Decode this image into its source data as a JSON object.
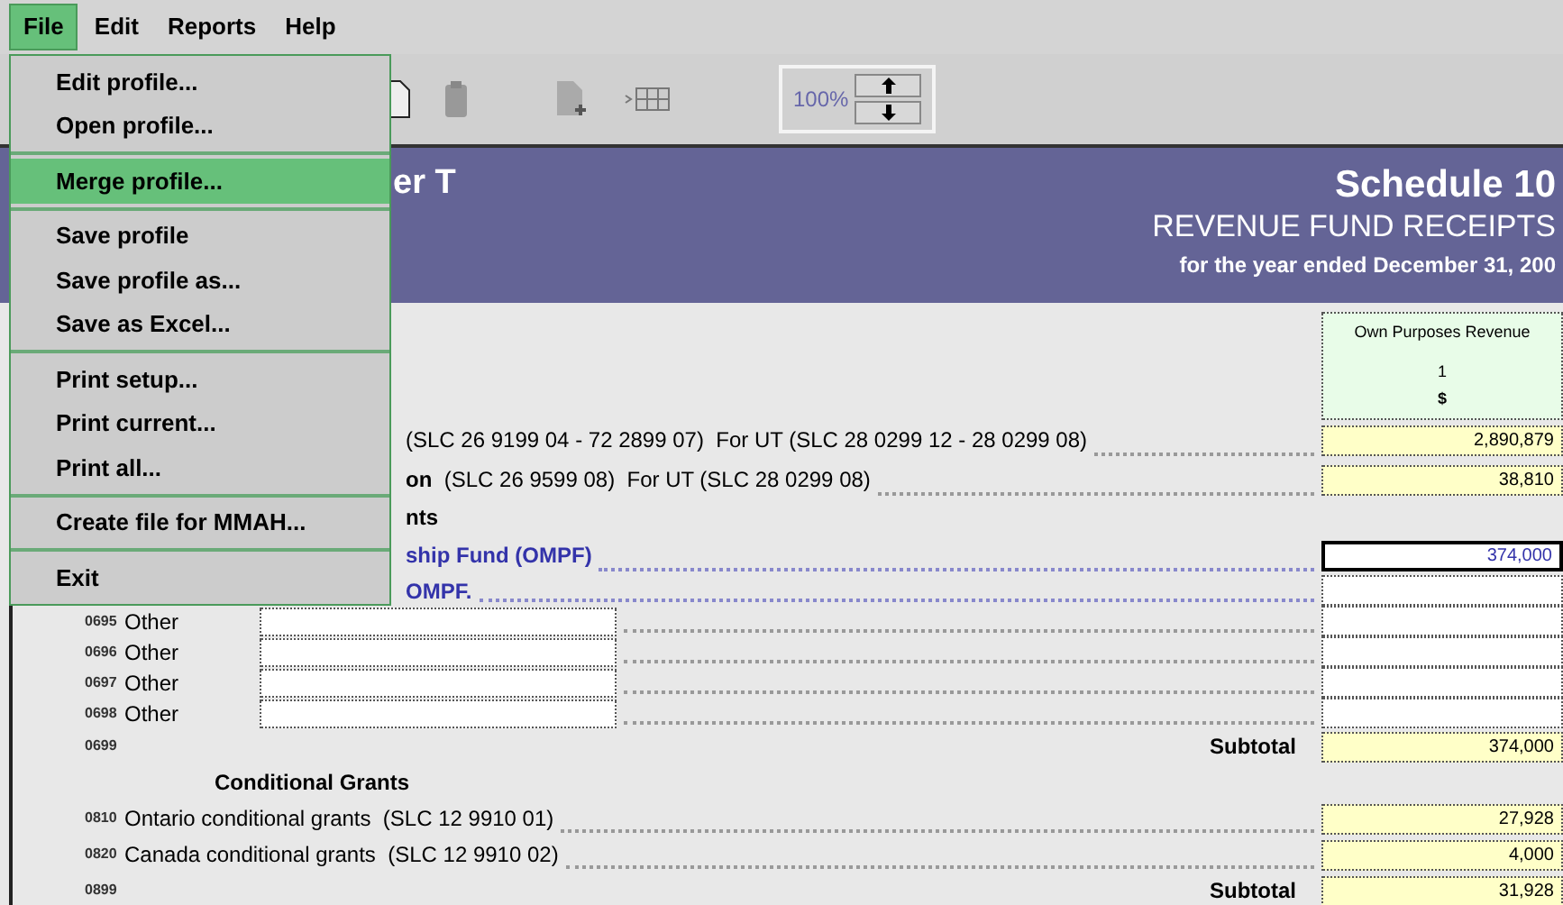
{
  "menubar": [
    {
      "label": "File",
      "selected": true
    },
    {
      "label": "Edit",
      "selected": false
    },
    {
      "label": "Reports",
      "selected": false
    },
    {
      "label": "Help",
      "selected": false
    }
  ],
  "file_menu": {
    "groups": [
      [
        {
          "label": "Edit profile...",
          "selected": false
        },
        {
          "label": "Open profile...",
          "selected": false
        }
      ],
      [
        {
          "label": "Merge profile...",
          "selected": true
        }
      ],
      [
        {
          "label": "Save profile",
          "selected": false
        },
        {
          "label": "Save profile as...",
          "selected": false
        },
        {
          "label": "Save as Excel...",
          "selected": false
        }
      ],
      [
        {
          "label": "Print setup...",
          "selected": false
        },
        {
          "label": "Print current...",
          "selected": false
        },
        {
          "label": "Print all...",
          "selected": false
        }
      ],
      [
        {
          "label": "Create file for MMAH...",
          "selected": false
        }
      ],
      [
        {
          "label": "Exit",
          "selected": false
        }
      ]
    ]
  },
  "toolbar": {
    "zoom": "100%"
  },
  "header": {
    "title": "er T",
    "schedule": "Schedule 10",
    "subtitle": "REVENUE FUND RECEIPTS",
    "period": "for the year ended December 31, 200"
  },
  "column": {
    "title": "Own Purposes Revenue",
    "number": "1",
    "unit": "$"
  },
  "rows": [
    {
      "kind": "line",
      "covered": true,
      "blue": false,
      "text": "(SLC 26 9199 04 - 72 2899 07)  For UT (SLC 28 0299 12 - 28 0299 08)",
      "computed": true,
      "value": "2,890,879"
    },
    {
      "kind": "line",
      "covered": true,
      "blue": false,
      "text": "**on**  (SLC 26 9599 08)  For UT (SLC 28 0299 08)",
      "computed": true,
      "value": "38,810"
    },
    {
      "kind": "heading",
      "covered": true,
      "text": "nts"
    },
    {
      "kind": "line",
      "covered": true,
      "blue": true,
      "text": "ship Fund (OMPF)",
      "computed": false,
      "focused": true,
      "value": "374,000"
    },
    {
      "kind": "line",
      "covered": true,
      "blue": true,
      "text": "OMPF.",
      "computed": false,
      "focused": false
    },
    {
      "kind": "other",
      "code": "0695",
      "text": "Other",
      "computed": false,
      "focused": false
    },
    {
      "kind": "other",
      "code": "0696",
      "text": "Other",
      "computed": false,
      "focused": false
    },
    {
      "kind": "other",
      "code": "0697",
      "text": "Other",
      "computed": false,
      "focused": false
    },
    {
      "kind": "other",
      "code": "0698",
      "text": "Other",
      "computed": false,
      "focused": false
    },
    {
      "kind": "subtotal",
      "code": "0699",
      "text": "Subtotal",
      "computed": true,
      "value": "374,000"
    },
    {
      "kind": "heading",
      "text": "Conditional Grants"
    },
    {
      "kind": "line",
      "blue": false,
      "code": "0810",
      "text": "Ontario conditional grants  (SLC 12 9910 01)",
      "computed": true,
      "value": "27,928"
    },
    {
      "kind": "line",
      "blue": false,
      "code": "0820",
      "text": "Canada conditional grants  (SLC 12 9910 02)",
      "computed": true,
      "value": "4,000"
    },
    {
      "kind": "subtotal",
      "code": "0899",
      "text": "Subtotal",
      "computed": true,
      "value": "31,928"
    }
  ]
}
